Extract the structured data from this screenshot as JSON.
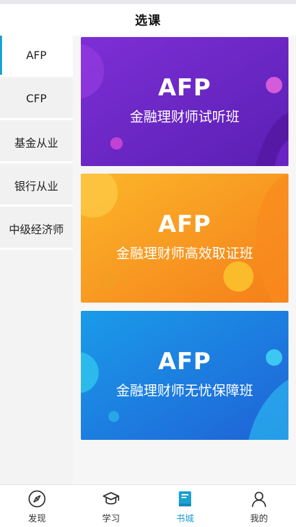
{
  "header": {
    "title": "选课"
  },
  "sidebar": {
    "items": [
      {
        "label": "AFP",
        "active": true
      },
      {
        "label": "CFP",
        "active": false
      },
      {
        "label": "基金从业",
        "active": false
      },
      {
        "label": "银行从业",
        "active": false
      },
      {
        "label": "中级经济师",
        "active": false
      }
    ]
  },
  "banners": [
    {
      "title": "AFP",
      "subtitle": "金融理财师试听班",
      "color": "#7a2fd0"
    },
    {
      "title": "AFP",
      "subtitle": "金融理财师高效取证班",
      "color": "#f7a21b"
    },
    {
      "title": "AFP",
      "subtitle": "金融理财师无忧保障班",
      "color": "#1e7fe0"
    }
  ],
  "tabbar": {
    "items": [
      {
        "label": "发现",
        "icon": "compass-icon",
        "active": false
      },
      {
        "label": "学习",
        "icon": "graduation-cap-icon",
        "active": false
      },
      {
        "label": "书城",
        "icon": "book-icon",
        "active": true
      },
      {
        "label": "我的",
        "icon": "user-icon",
        "active": false
      }
    ]
  },
  "colors": {
    "accent": "#1aa1d4"
  }
}
